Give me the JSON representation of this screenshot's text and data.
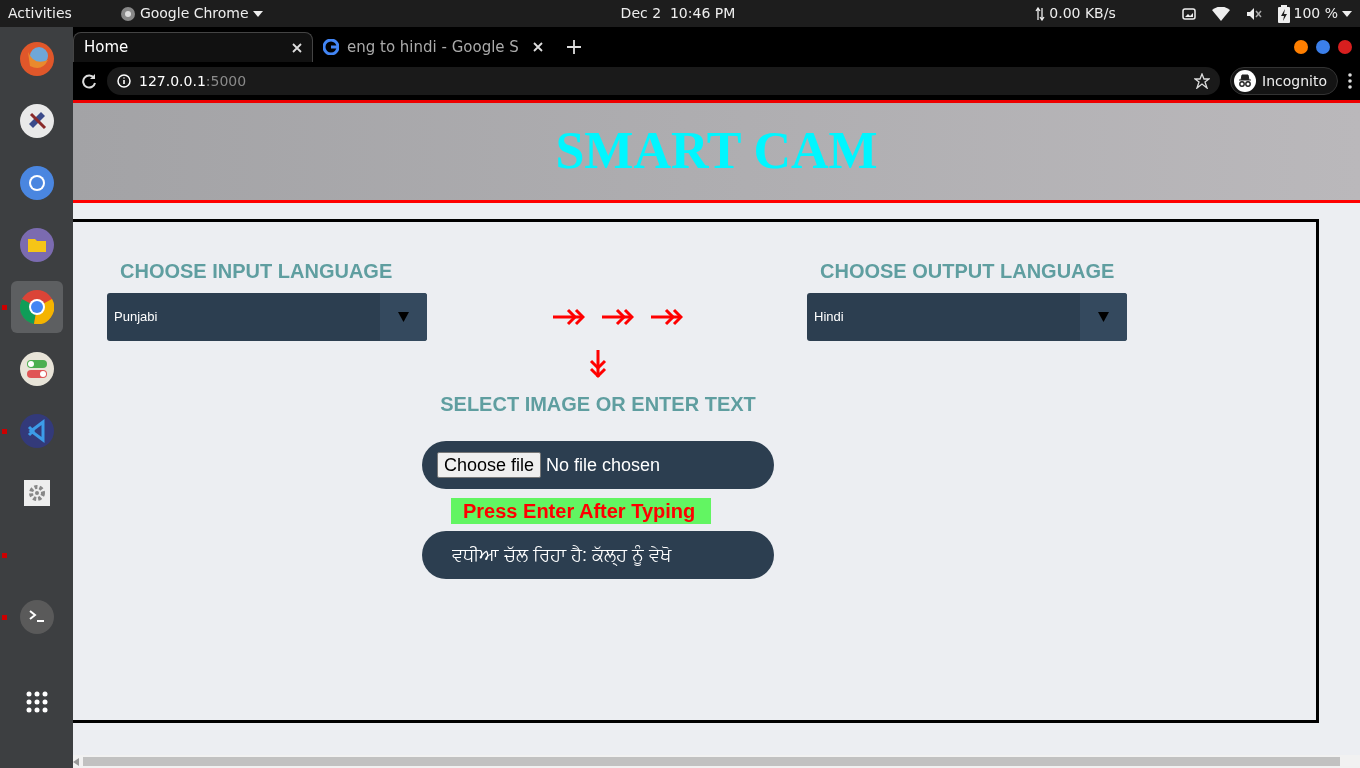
{
  "top_bar": {
    "activities": "Activities",
    "app_menu": "Google Chrome",
    "clock": "Dec 2  10:46 PM",
    "network": "0.00 KB/s",
    "battery": "100 %"
  },
  "dock": {
    "items": [
      {
        "running": false,
        "selected": false
      },
      {
        "running": false,
        "selected": false
      },
      {
        "running": false,
        "selected": false
      },
      {
        "running": false,
        "selected": false
      },
      {
        "running": true,
        "selected": true
      },
      {
        "running": false,
        "selected": false
      },
      {
        "running": true,
        "selected": false
      },
      {
        "running": false,
        "selected": false
      },
      {
        "running": true,
        "selected": false
      },
      {
        "running": true,
        "selected": false
      }
    ]
  },
  "browser": {
    "tabs": [
      {
        "label": "Home",
        "selected": true
      },
      {
        "label": "eng to hindi - Google S",
        "selected": false
      }
    ],
    "address": {
      "host": "127.0.0.1",
      "port": ":5000"
    },
    "profile": "Incognito"
  },
  "page": {
    "title": "SMART CAM",
    "input_language": {
      "label": "CHOOSE INPUT LANGUAGE",
      "value": "Punjabi"
    },
    "output_language": {
      "label": "CHOOSE OUTPUT LANGUAGE",
      "value": "Hindi"
    },
    "source_label": "SELECT IMAGE OR ENTER TEXT",
    "file": {
      "button": "Choose file",
      "status": "No file chosen"
    },
    "hint": "Press Enter After Typing",
    "text_input": {
      "value": "ਵਧੀਆ ਚੱਲ ਰਿਹਾ ਹੈ: ਕੱਲ੍ਹ ਨੂੰ ਵੇਖੋ"
    }
  }
}
